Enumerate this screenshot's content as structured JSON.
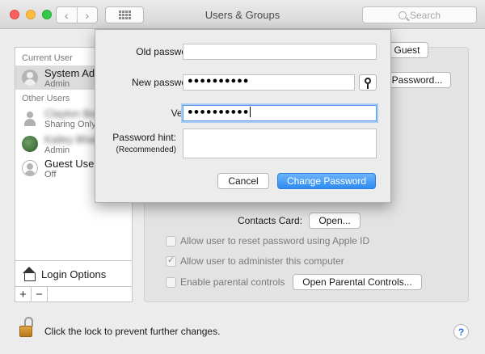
{
  "window": {
    "title": "Users & Groups",
    "search_placeholder": "Search",
    "back_glyph": "‹",
    "forward_glyph": "›"
  },
  "sidebar": {
    "current_user_header": "Current User",
    "other_users_header": "Other Users",
    "users": [
      {
        "name": "System Administrator",
        "role": "Admin",
        "avatar": "person-silhouette-icon",
        "selected": true
      },
      {
        "name": "Clayton Bose",
        "role": "Sharing Only",
        "avatar": "person-silhouette-icon",
        "blurred": true
      },
      {
        "name": "Kailey Bhatt",
        "role": "Admin",
        "avatar": "photo-avatar",
        "blurred": true
      },
      {
        "name": "Guest User",
        "role": "Off",
        "avatar": "guest-icon"
      }
    ],
    "login_options_label": "Login Options",
    "add_label": "+",
    "remove_label": "−"
  },
  "main": {
    "guest_button_label": "Guest",
    "password_button_label": "Password...",
    "contacts_card_label": "Contacts Card:",
    "open_button_label": "Open...",
    "checkboxes": [
      {
        "label": "Allow user to reset password using Apple ID",
        "checked": false
      },
      {
        "label": "Allow user to administer this computer",
        "checked": true
      },
      {
        "label": "Enable parental controls",
        "checked": false
      }
    ],
    "open_parental_controls_label": "Open Parental Controls..."
  },
  "footer": {
    "lock_text": "Click the lock to prevent further changes.",
    "help_label": "?"
  },
  "sheet": {
    "old_password_label": "Old password:",
    "old_password_value": "",
    "new_password_label": "New password:",
    "new_password_value": "●●●●●●●●●●",
    "verify_label": "Verify:",
    "verify_value": "●●●●●●●●●●",
    "hint_label": "Password hint:",
    "hint_sublabel": "(Recommended)",
    "hint_value": "",
    "cancel_label": "Cancel",
    "change_label": "Change Password"
  },
  "colors": {
    "accent": "#3a93f5",
    "focus_ring": "#a8cbf3",
    "lock": "#d19a3a"
  }
}
